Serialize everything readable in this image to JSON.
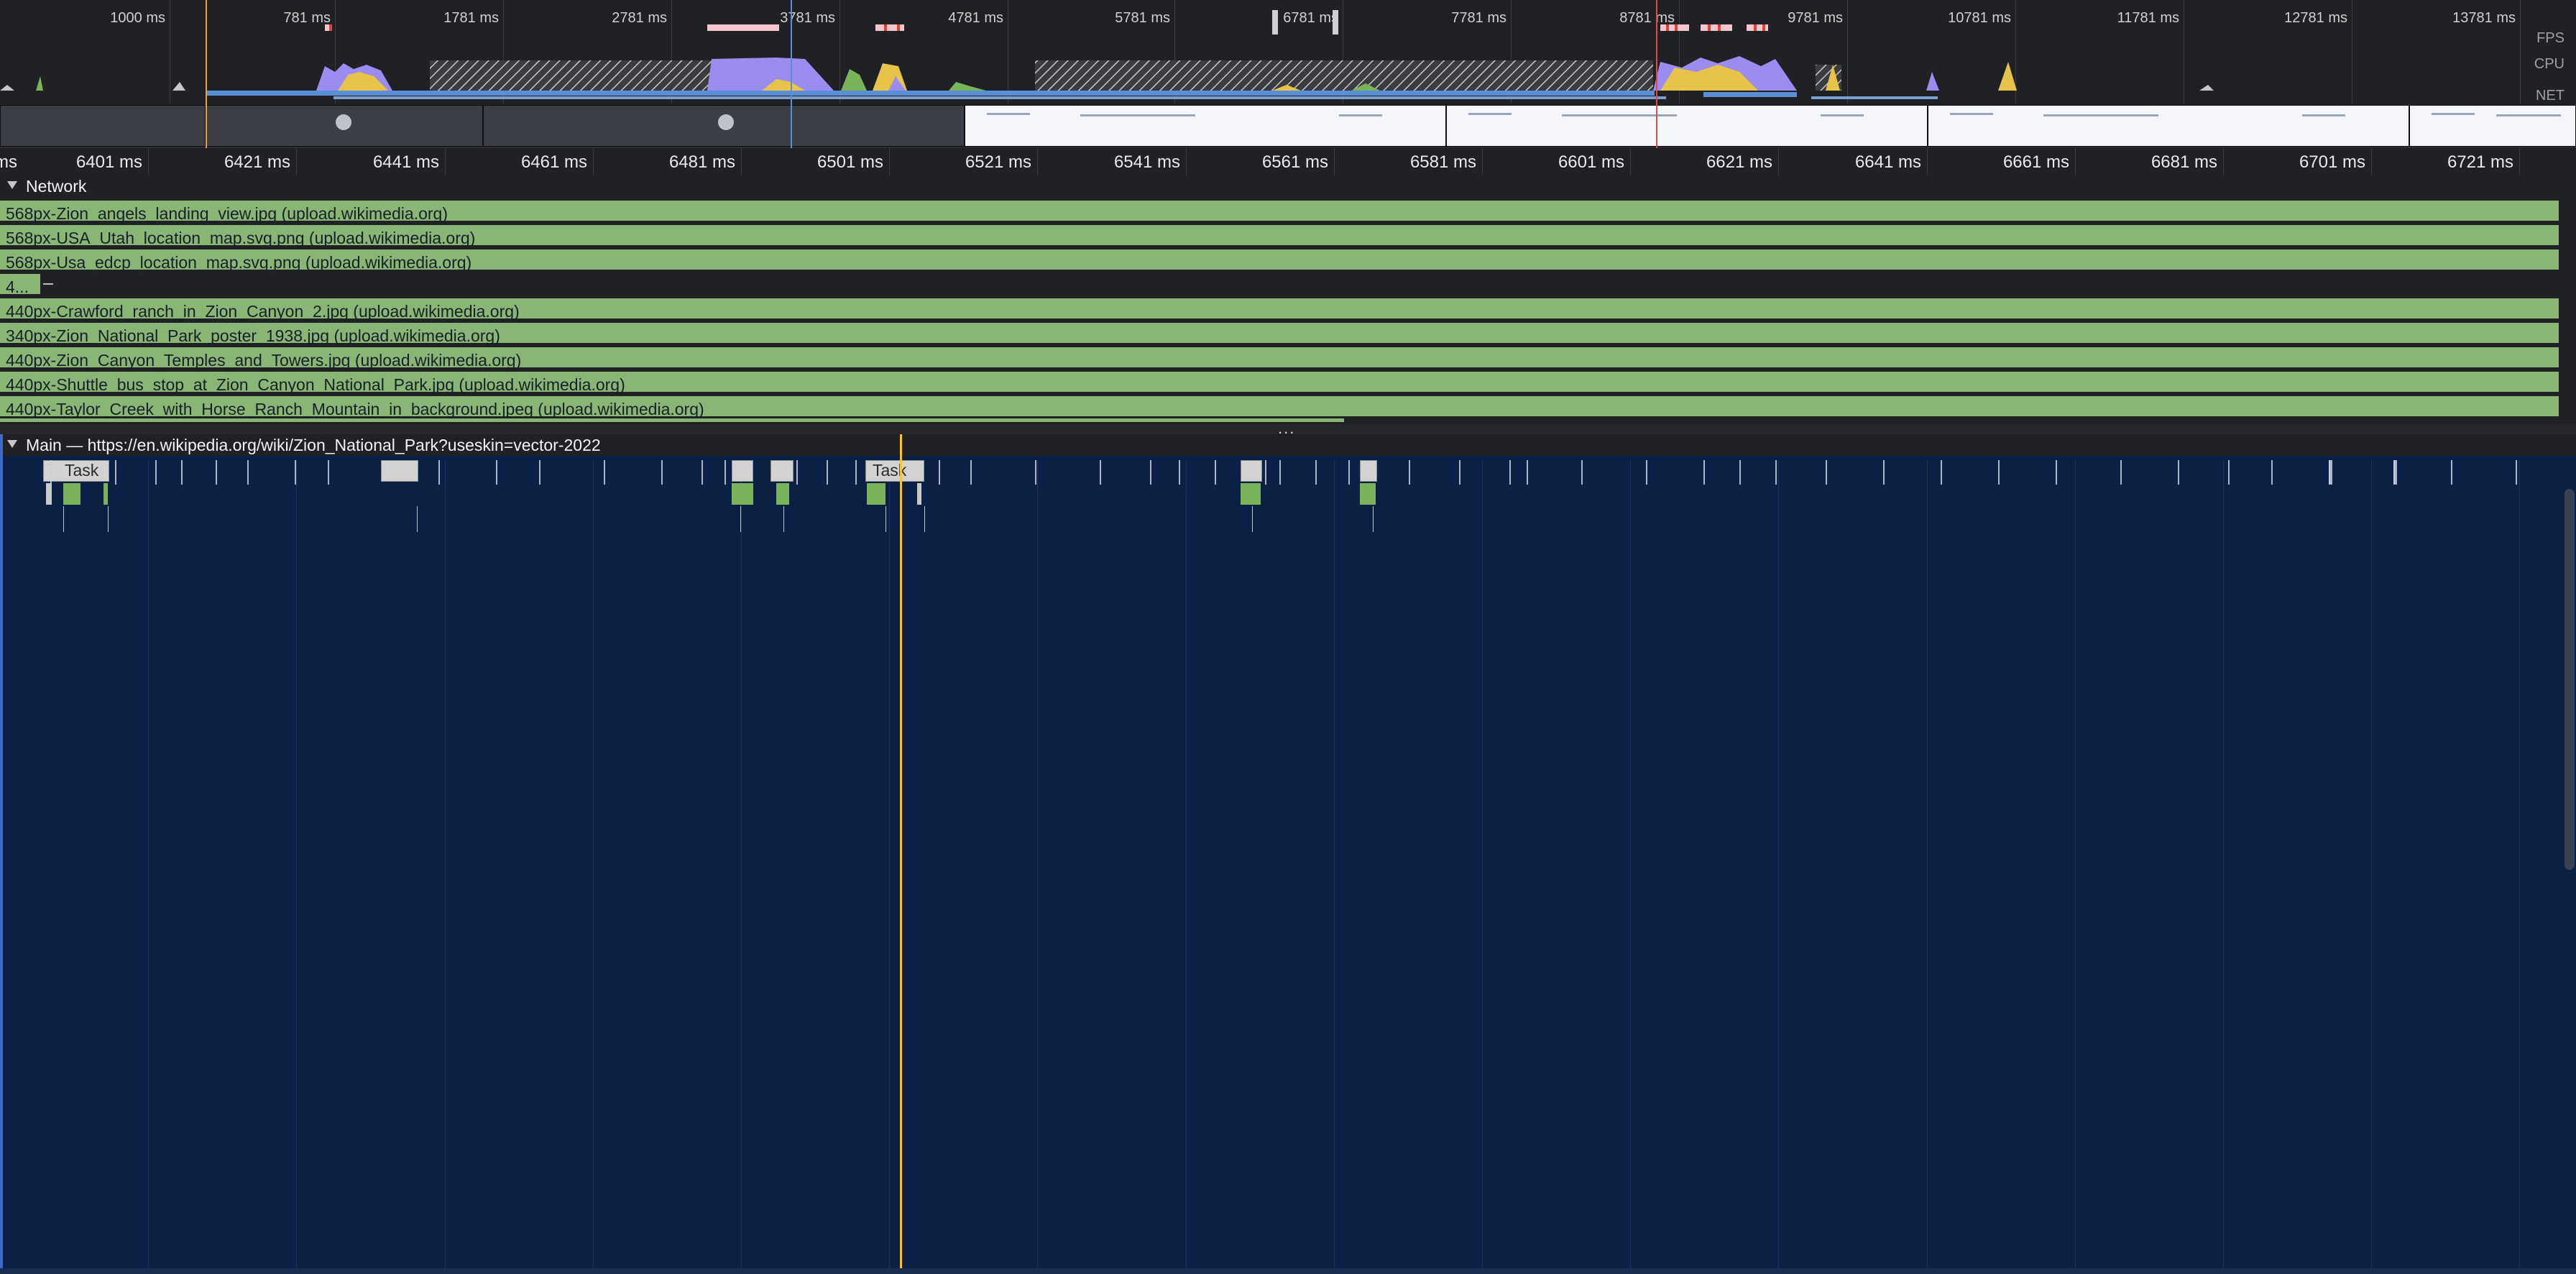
{
  "overview": {
    "tick_labels": [
      "1000 ms",
      "781 ms",
      "1781 ms",
      "2781 ms",
      "3781 ms",
      "4781 ms",
      "5781 ms",
      "6781 ms",
      "7781 ms",
      "8781 ms",
      "9781 ms",
      "10781 ms",
      "11781 ms",
      "12781 ms",
      "13781 ms"
    ],
    "track_labels": {
      "fps": "FPS",
      "cpu": "CPU",
      "net": "NET"
    }
  },
  "ruler": {
    "labels": [
      "ms",
      "6401 ms",
      "6421 ms",
      "6441 ms",
      "6461 ms",
      "6481 ms",
      "6501 ms",
      "6521 ms",
      "6541 ms",
      "6561 ms",
      "6581 ms",
      "6601 ms",
      "6621 ms",
      "6641 ms",
      "6661 ms",
      "6681 ms",
      "6701 ms",
      "6721 ms"
    ]
  },
  "network": {
    "title": "Network",
    "requests": [
      {
        "label": "568px-Zion_angels_landing_view.jpg (upload.wikimedia.org)"
      },
      {
        "label": "568px-USA_Utah_location_map.svg.png (upload.wikimedia.org)"
      },
      {
        "label": "568px-Usa_edcp_location_map.svg.png (upload.wikimedia.org)"
      },
      {
        "label": "4..."
      },
      {
        "label": "440px-Crawford_ranch_in_Zion_Canyon_2.jpg (upload.wikimedia.org)"
      },
      {
        "label": "340px-Zion_National_Park_poster_1938.jpg (upload.wikimedia.org)"
      },
      {
        "label": "440px-Zion_Canyon_Temples_and_Towers.jpg (upload.wikimedia.org)"
      },
      {
        "label": "440px-Shuttle_bus_stop_at_Zion_Canyon_National_Park.jpg (upload.wikimedia.org)"
      },
      {
        "label": "440px-Taylor_Creek_with_Horse_Ranch_Mountain_in_background.jpeg (upload.wikimedia.org)"
      }
    ]
  },
  "resizer": {
    "dots": "..."
  },
  "main": {
    "title": "Main — https://en.wikipedia.org/wiki/Zion_National_Park?useskin=vector-2022",
    "tasks": [
      {
        "label": "Task"
      },
      {
        "label": "Task"
      }
    ]
  },
  "colors": {
    "main_background": "#0c1f45",
    "panel_background": "#202124",
    "request_bar": "#8bb574",
    "playhead": "#f3c43a",
    "cpu_scripting": "#e7c34a",
    "cpu_rendering": "#9b8cf0",
    "cpu_painting": "#7ab45a",
    "net_bar": "#5a8fd6"
  }
}
